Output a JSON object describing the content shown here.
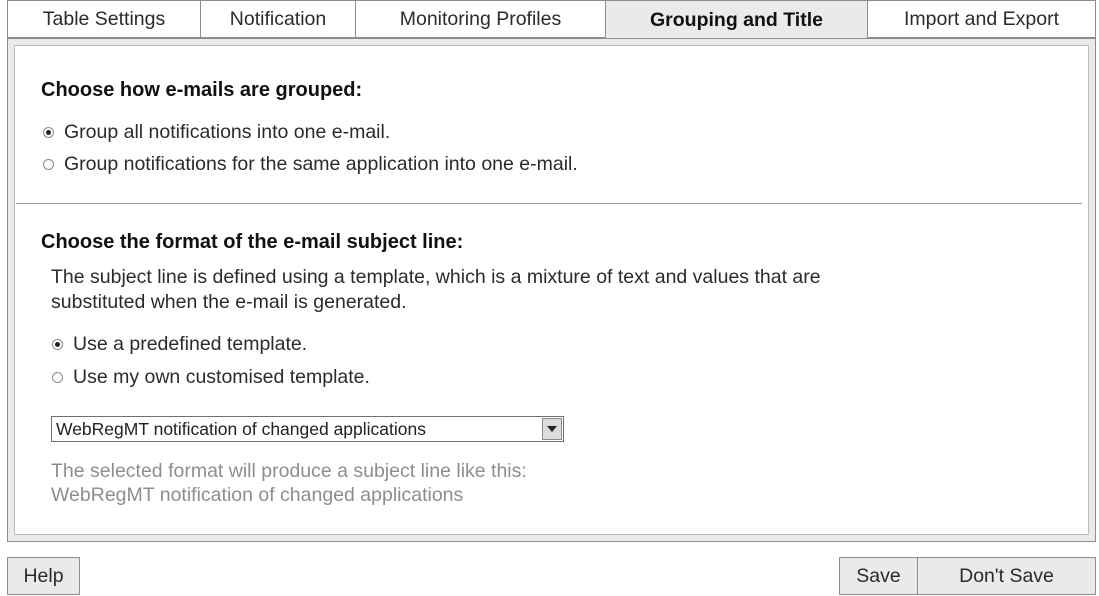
{
  "tabs": [
    {
      "label": "Table Settings",
      "active": false
    },
    {
      "label": "Notification",
      "active": false
    },
    {
      "label": "Monitoring Profiles",
      "active": false
    },
    {
      "label": "Grouping and Title",
      "active": true
    },
    {
      "label": "Import and Export",
      "active": false
    }
  ],
  "grouping": {
    "heading": "Choose how e-mails are grouped:",
    "options": [
      {
        "label": "Group all notifications into one e-mail.",
        "selected": true
      },
      {
        "label": "Group notifications for the same application into one e-mail.",
        "selected": false
      }
    ]
  },
  "subject": {
    "heading": "Choose the format of the e-mail subject line:",
    "description_line1": "The subject line is defined using a template, which is a mixture of text and values that are",
    "description_line2": "substituted when the e-mail is generated.",
    "options": [
      {
        "label": "Use a predefined template.",
        "selected": true
      },
      {
        "label": "Use my own customised template.",
        "selected": false
      }
    ],
    "template_select_value": "WebRegMT notification of changed applications",
    "preview_label": "The selected format will produce a subject line like this:",
    "preview_value": "WebRegMT notification of changed applications"
  },
  "buttons": {
    "help": "Help",
    "save": "Save",
    "dont_save": "Don't Save"
  }
}
